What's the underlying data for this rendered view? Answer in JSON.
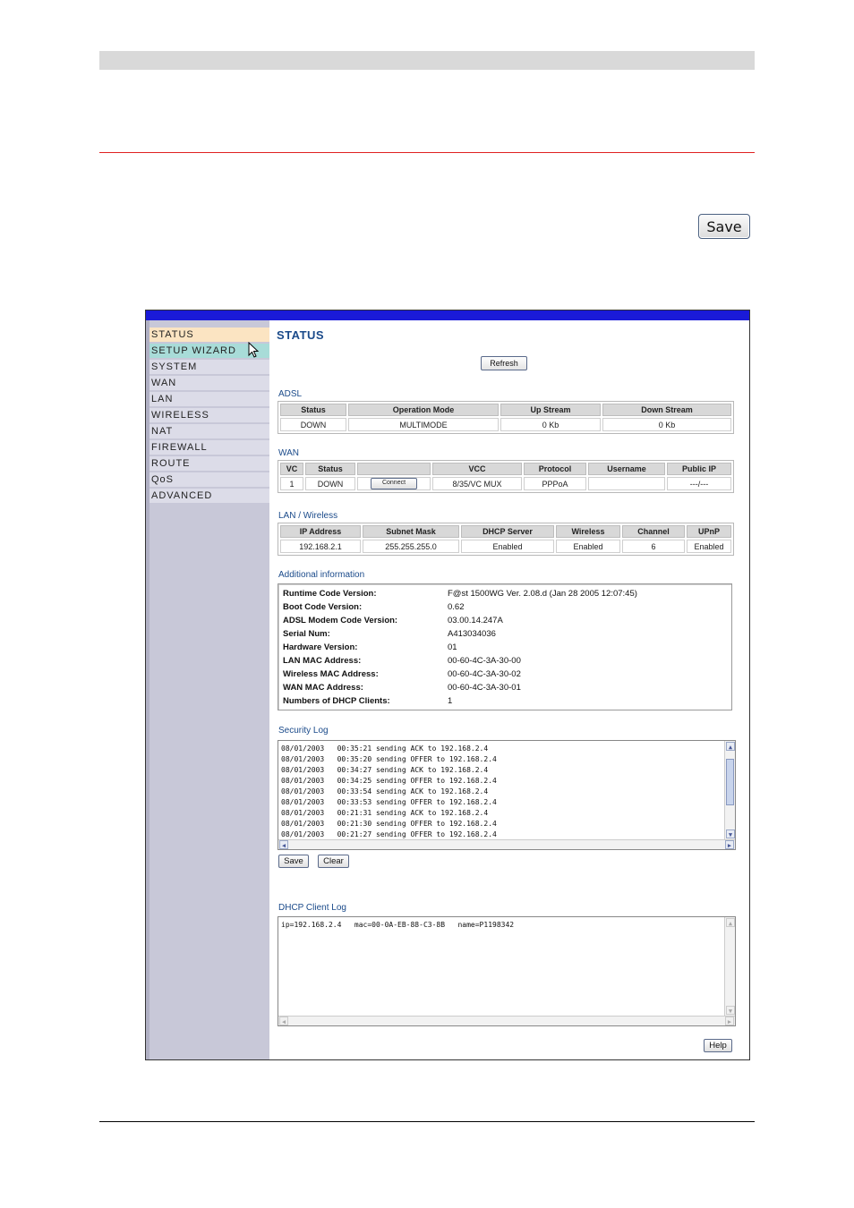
{
  "doc": {
    "save_label": "Save"
  },
  "sidebar": {
    "items": [
      "STATUS",
      "SETUP WIZARD",
      "SYSTEM",
      "WAN",
      "LAN",
      "WIRELESS",
      "NAT",
      "FIREWALL",
      "ROUTE",
      "QoS",
      "ADVANCED"
    ],
    "active": "STATUS",
    "hovered": "SETUP WIZARD"
  },
  "page": {
    "title": "STATUS",
    "refresh_label": "Refresh"
  },
  "adsl": {
    "label": "ADSL",
    "headers": [
      "Status",
      "Operation Mode",
      "Up Stream",
      "Down Stream"
    ],
    "row": [
      "DOWN",
      "MULTIMODE",
      "0 Kb",
      "0 Kb"
    ]
  },
  "wan": {
    "label": "WAN",
    "headers": [
      "VC",
      "Status",
      "",
      "VCC",
      "Protocol",
      "Username",
      "Public IP"
    ],
    "row": [
      "1",
      "DOWN",
      "Connect",
      "8/35/VC MUX",
      "PPPoA",
      "",
      "---/---"
    ]
  },
  "lan": {
    "label": "LAN / Wireless",
    "headers": [
      "IP Address",
      "Subnet Mask",
      "DHCP Server",
      "Wireless",
      "Channel",
      "UPnP"
    ],
    "row": [
      "192.168.2.1",
      "255.255.255.0",
      "Enabled",
      "Enabled",
      "6",
      "Enabled"
    ]
  },
  "info": {
    "label": "Additional information",
    "rows": [
      {
        "k": "Runtime Code Version:",
        "v": "F@st 1500WG Ver. 2.08.d (Jan 28 2005 12:07:45)"
      },
      {
        "k": "Boot Code Version:",
        "v": "0.62"
      },
      {
        "k": "ADSL Modem Code Version:",
        "v": "03.00.14.247A"
      },
      {
        "k": "Serial Num:",
        "v": "A413034036"
      },
      {
        "k": "Hardware Version:",
        "v": "01"
      },
      {
        "k": "LAN MAC Address:",
        "v": "00-60-4C-3A-30-00"
      },
      {
        "k": "Wireless MAC Address:",
        "v": "00-60-4C-3A-30-02"
      },
      {
        "k": "WAN MAC Address:",
        "v": "00-60-4C-3A-30-01"
      },
      {
        "k": "Numbers of DHCP Clients:",
        "v": "1"
      }
    ]
  },
  "security_log": {
    "label": "Security Log",
    "lines": [
      "08/01/2003   00:35:21 sending ACK to 192.168.2.4",
      "08/01/2003   00:35:20 sending OFFER to 192.168.2.4",
      "08/01/2003   00:34:27 sending ACK to 192.168.2.4",
      "08/01/2003   00:34:25 sending OFFER to 192.168.2.4",
      "08/01/2003   00:33:54 sending ACK to 192.168.2.4",
      "08/01/2003   00:33:53 sending OFFER to 192.168.2.4",
      "08/01/2003   00:21:31 sending ACK to 192.168.2.4",
      "08/01/2003   00:21:30 sending OFFER to 192.168.2.4",
      "08/01/2003   00:21:27 sending OFFER to 192.168.2.4"
    ],
    "save_label": "Save",
    "clear_label": "Clear"
  },
  "dhcp_log": {
    "label": "DHCP Client Log",
    "lines": [
      "ip=192.168.2.4   mac=00-0A-EB-88-C3-8B   name=P1198342"
    ]
  },
  "help_label": "Help"
}
